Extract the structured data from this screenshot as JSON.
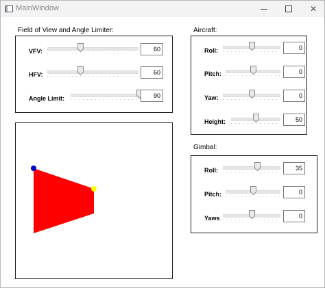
{
  "window": {
    "title": "MainWindow",
    "minimize_icon": "minimize-icon",
    "maximize_icon": "maximize-icon",
    "close_icon": "close-icon"
  },
  "fov_group": {
    "title": "Field of View and Angle Limiter:",
    "rows": [
      {
        "label": "VFV:",
        "value": "60",
        "fraction": 0.36
      },
      {
        "label": "HFV:",
        "value": "60",
        "fraction": 0.36
      },
      {
        "label": "Angle Limit:",
        "value": "90",
        "fraction": 1.0
      }
    ]
  },
  "aircraft_group": {
    "title": "Aircraft:",
    "rows": [
      {
        "label": "Roll:",
        "value": "0",
        "fraction": 0.5
      },
      {
        "label": "Pitch:",
        "value": "0",
        "fraction": 0.5
      },
      {
        "label": "Yaw:",
        "value": "0",
        "fraction": 0.5
      },
      {
        "label": "Height:",
        "value": "50",
        "fraction": 0.5
      }
    ]
  },
  "gimbal_group": {
    "title": "Gimbal:",
    "rows": [
      {
        "label": "Roll:",
        "value": "35",
        "fraction": 0.6
      },
      {
        "label": "Pitch:",
        "value": "0",
        "fraction": 0.5
      },
      {
        "label": "Yaws",
        "value": "0",
        "fraction": 0.5
      }
    ]
  },
  "canvas": {
    "polygon_color": "#ff0000",
    "corner_point_color": "#0000cc",
    "side_point_color": "#ffff00"
  }
}
